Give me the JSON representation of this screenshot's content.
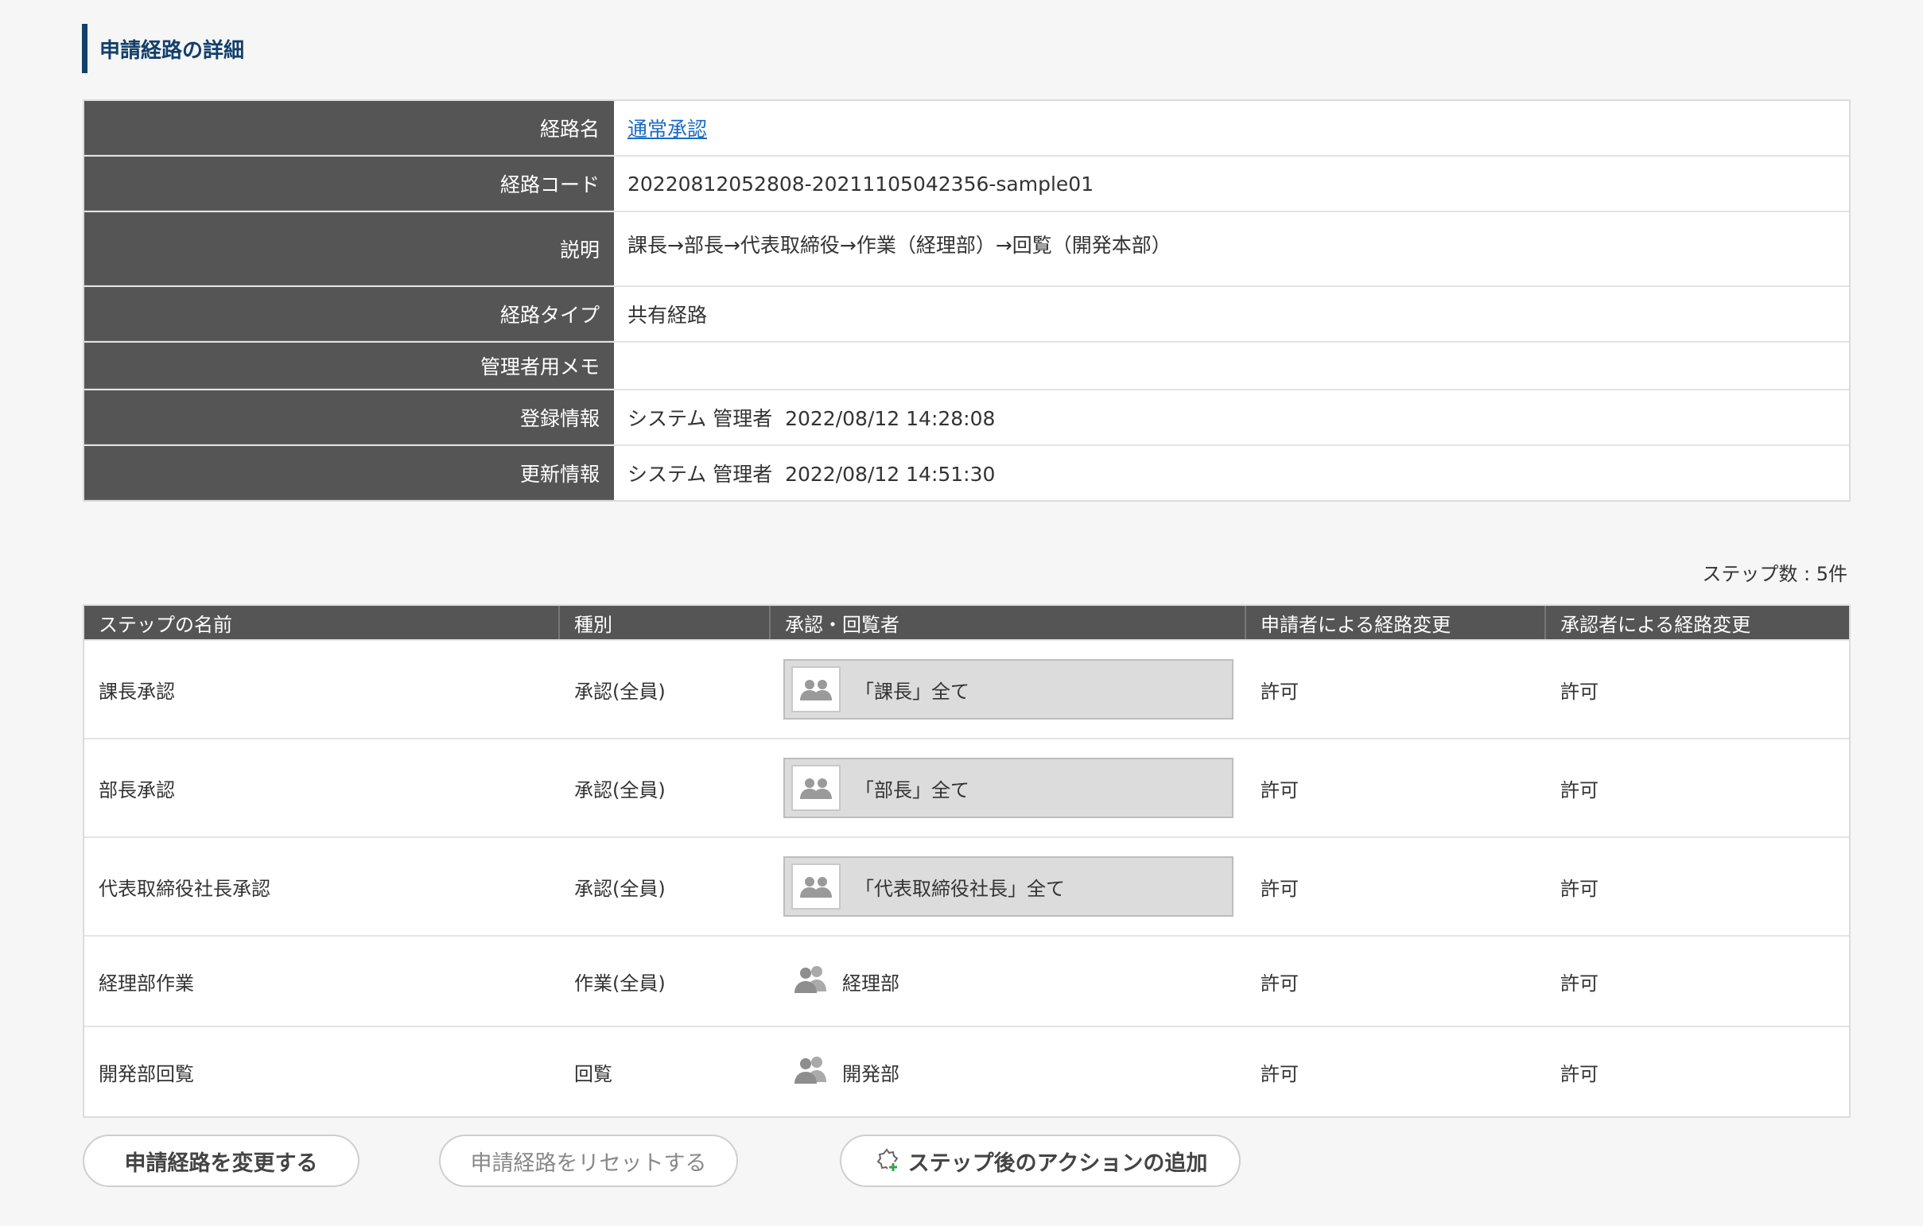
{
  "section_title": "申請経路の詳細",
  "detail": {
    "route_name_label": "経路名",
    "route_name_value": "通常承認",
    "route_code_label": "経路コード",
    "route_code_value": "20220812052808-20211105042356-sample01",
    "description_label": "説明",
    "description_value": "課長→部長→代表取締役→作業（経理部）→回覧（開発本部）",
    "route_type_label": "経路タイプ",
    "route_type_value": "共有経路",
    "admin_memo_label": "管理者用メモ",
    "admin_memo_value": "",
    "registered_label": "登録情報",
    "registered_value": "システム 管理者  2022/08/12 14:28:08",
    "updated_label": "更新情報",
    "updated_value": "システム 管理者  2022/08/12 14:51:30"
  },
  "step_count": "ステップ数 : 5件",
  "steps": {
    "headers": [
      "ステップの名前",
      "種別",
      "承認・回覧者",
      "申請者による経路変更",
      "承認者による経路変更"
    ],
    "rows": [
      {
        "name": "課長承認",
        "type": "承認(全員)",
        "approver": "「課長」全て",
        "applicant_change": "許可",
        "approver_change": "許可"
      },
      {
        "name": "部長承認",
        "type": "承認(全員)",
        "approver": "「部長」全て",
        "applicant_change": "許可",
        "approver_change": "許可"
      },
      {
        "name": "代表取締役社長承認",
        "type": "承認(全員)",
        "approver": "「代表取締役社長」全て",
        "applicant_change": "許可",
        "approver_change": "許可"
      },
      {
        "name": "経理部作業",
        "type": "作業(全員)",
        "approver": "経理部",
        "applicant_change": "許可",
        "approver_change": "許可"
      },
      {
        "name": "開発部回覧",
        "type": "回覧",
        "approver": "開発部",
        "applicant_change": "許可",
        "approver_change": "許可"
      }
    ]
  },
  "buttons": {
    "change": "申請経路を変更する",
    "reset": "申請経路をリセットする",
    "add_action": "ステップ後のアクションの追加"
  },
  "icons": {
    "person_group": "users-icon",
    "add_action": "gear-plus-icon"
  },
  "colors": {
    "title_accent": "#123f6b",
    "header_bg": "#555555",
    "link": "#1a6bc4"
  }
}
